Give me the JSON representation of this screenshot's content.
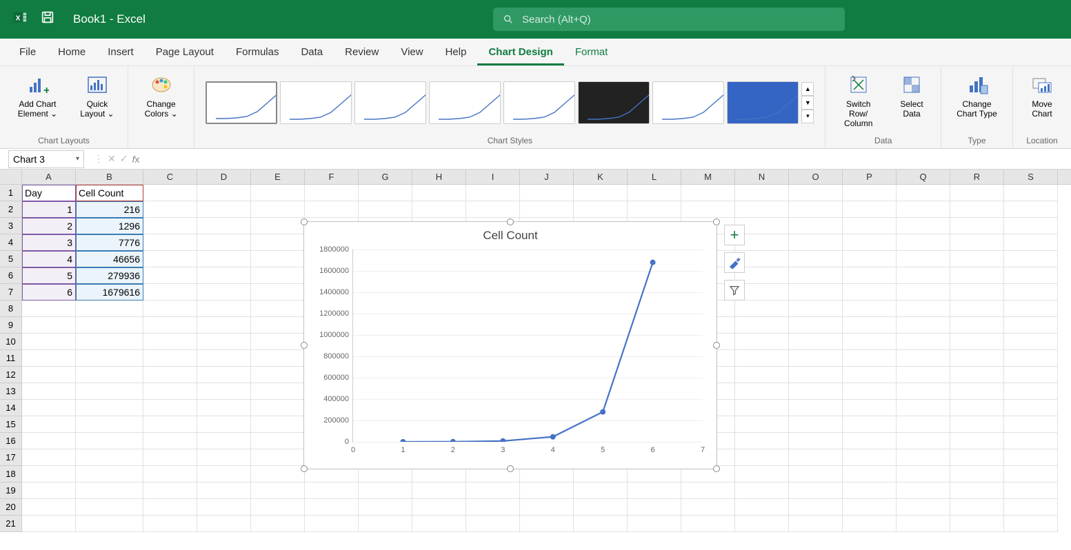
{
  "titlebar": {
    "title": "Book1  -  Excel",
    "search_placeholder": "Search (Alt+Q)"
  },
  "tabs": [
    "File",
    "Home",
    "Insert",
    "Page Layout",
    "Formulas",
    "Data",
    "Review",
    "View",
    "Help",
    "Chart Design",
    "Format"
  ],
  "active_tab": "Chart Design",
  "ribbon": {
    "chart_layouts": {
      "label": "Chart Layouts",
      "add_element": "Add Chart Element ⌄",
      "quick_layout": "Quick Layout ⌄"
    },
    "change_colors": "Change Colors ⌄",
    "chart_styles_label": "Chart Styles",
    "data_group": {
      "label": "Data",
      "switch": "Switch Row/ Column",
      "select": "Select Data"
    },
    "type_group": {
      "label": "Type",
      "change_type": "Change Chart Type"
    },
    "location_group": {
      "label": "Location",
      "move": "Move Chart"
    }
  },
  "namebox": "Chart 3",
  "formula_value": "",
  "columns": [
    "A",
    "B",
    "C",
    "D",
    "E",
    "F",
    "G",
    "H",
    "I",
    "J",
    "K",
    "L",
    "M",
    "N",
    "O",
    "P",
    "Q",
    "R",
    "S"
  ],
  "sheet": {
    "headers": {
      "A": "Day",
      "B": "Cell Count"
    },
    "rows": [
      {
        "A": "1",
        "B": "216"
      },
      {
        "A": "2",
        "B": "1296"
      },
      {
        "A": "3",
        "B": "7776"
      },
      {
        "A": "4",
        "B": "46656"
      },
      {
        "A": "5",
        "B": "279936"
      },
      {
        "A": "6",
        "B": "1679616"
      }
    ]
  },
  "chart_data": {
    "type": "line",
    "title": "Cell Count",
    "x": [
      1,
      2,
      3,
      4,
      5,
      6
    ],
    "values": [
      216,
      1296,
      7776,
      46656,
      279936,
      1679616
    ],
    "xlabel": "",
    "ylabel": "",
    "xlim": [
      0,
      7
    ],
    "ylim": [
      0,
      1800000
    ],
    "xticks": [
      0,
      1,
      2,
      3,
      4,
      5,
      6,
      7
    ],
    "yticks": [
      0,
      200000,
      400000,
      600000,
      800000,
      1000000,
      1200000,
      1400000,
      1600000,
      1800000
    ]
  },
  "chart_side": {
    "elements": "+",
    "styles": "brush",
    "filter": "funnel"
  }
}
